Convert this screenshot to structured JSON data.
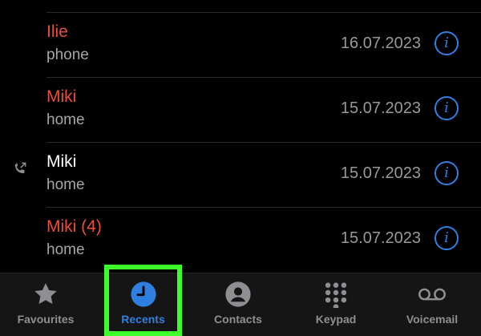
{
  "calls": [
    {
      "name": "Ilie",
      "type": "phone",
      "date": "16.07.2023",
      "missed": true,
      "outgoing": false
    },
    {
      "name": "Miki",
      "type": "home",
      "date": "15.07.2023",
      "missed": true,
      "outgoing": false
    },
    {
      "name": "Miki",
      "type": "home",
      "date": "15.07.2023",
      "missed": false,
      "outgoing": true
    },
    {
      "name": "Miki (4)",
      "type": "home",
      "date": "15.07.2023",
      "missed": true,
      "outgoing": false
    }
  ],
  "info_glyph": "i",
  "tabs": [
    {
      "id": "favourites",
      "label": "Favourites",
      "icon": "star-icon",
      "active": false
    },
    {
      "id": "recents",
      "label": "Recents",
      "icon": "clock-icon",
      "active": true
    },
    {
      "id": "contacts",
      "label": "Contacts",
      "icon": "person-circle-icon",
      "active": false
    },
    {
      "id": "keypad",
      "label": "Keypad",
      "icon": "keypad-icon",
      "active": false
    },
    {
      "id": "voicemail",
      "label": "Voicemail",
      "icon": "voicemail-icon",
      "active": false
    }
  ],
  "colors": {
    "missed": "#eb4d3d",
    "accent": "#2f7fe0",
    "inactive": "#8e8e93",
    "highlight": "#3fff2a"
  }
}
